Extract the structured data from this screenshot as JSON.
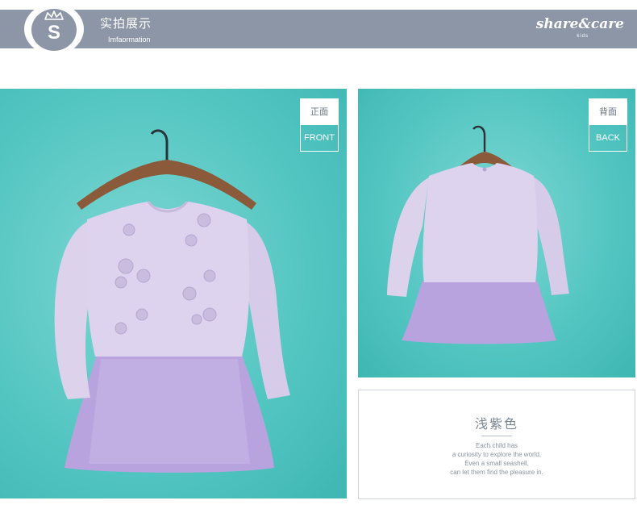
{
  "header": {
    "logo_letter": "S",
    "title": "实拍展示",
    "subtitle": "Imfaormation",
    "brand": "share&care",
    "brand_sub": "kids",
    "bar_color": "#8c96a6"
  },
  "front_panel": {
    "tag_cn": "正面",
    "tag_en": "FRONT"
  },
  "back_panel": {
    "tag_cn": "背面",
    "tag_en": "BACK"
  },
  "description": {
    "color_name": "浅紫色",
    "lines": [
      "Each child has",
      "a curiosity to explore the world,",
      "Even a small seashell,",
      "can let them find the pleasure in."
    ]
  },
  "colors": {
    "background_teal": "#52c5c1",
    "dress_top": "#ddd3ee",
    "dress_tulle": "#b8a3df",
    "hanger_wood": "#8a5a3a"
  }
}
